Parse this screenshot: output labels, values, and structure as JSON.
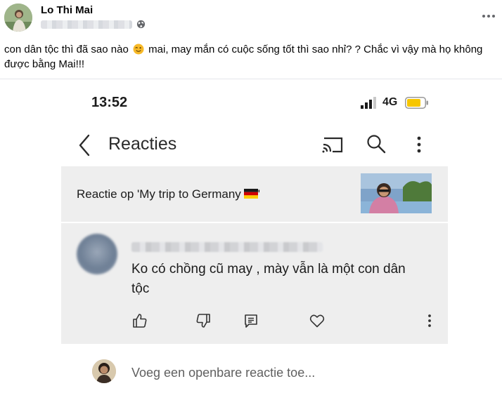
{
  "post": {
    "author_name": "Lo Thi Mai",
    "text_part1": "con dân tộc thì đã sao nào",
    "text_emoji": "wink-emoji",
    "text_part2": " mai,  may mắn có cuộc sống tốt thì sao nhỉ? ? Chắc vì vậy mà họ không được bằng Mai!!!",
    "privacy_icon": "globe-icon",
    "menu_icon": "more-horizontal-icon"
  },
  "phone": {
    "status_bar": {
      "time": "13:52",
      "network": "4G",
      "battery_color": "#f7c600"
    },
    "app_bar": {
      "back_icon": "chevron-left-icon",
      "title": "Reacties",
      "icons": [
        "cast-icon",
        "search-icon",
        "more-vertical-icon"
      ]
    },
    "video": {
      "title": "Reactie op 'My trip to Germany",
      "title_suffix": "'",
      "flag_icon": "germany-flag-icon"
    },
    "comment": {
      "text": "Ko có chồng cũ may , mày vẫn là một con dân tộc",
      "actions": [
        "thumbs-up-icon",
        "thumbs-down-icon",
        "reply-icon",
        "heart-icon",
        "more-vertical-icon"
      ]
    },
    "reply_box": {
      "placeholder": "Voeg een openbare reactie toe..."
    }
  },
  "colors": {
    "panel_background": "#eeeeee",
    "separator": "#e4e6eb"
  }
}
